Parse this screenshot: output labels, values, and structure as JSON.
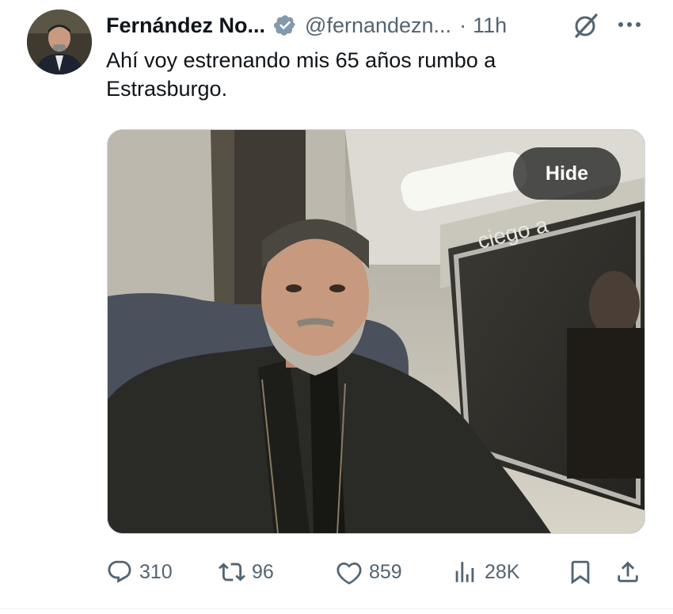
{
  "tweet": {
    "author_name": "Fernández No...",
    "author_handle": "@fernandezn...",
    "time_separator": "·",
    "time_ago": "11h",
    "text": "Ahí voy estrenando mis 65 años rumbo a Estrasburgo."
  },
  "media": {
    "hide_label": "Hide",
    "window_sign_text": "ciego a",
    "description": "selfie of a man seated on a train"
  },
  "actions": {
    "replies": "310",
    "reposts": "96",
    "likes": "859",
    "views": "28K"
  },
  "icons": [
    "verified-icon",
    "grok-icon",
    "more-icon",
    "reply-icon",
    "repost-icon",
    "like-icon",
    "views-icon",
    "bookmark-icon",
    "share-icon"
  ],
  "colors": {
    "text": "#0f1419",
    "secondary": "#536471",
    "verified_badge": "#829aab"
  }
}
